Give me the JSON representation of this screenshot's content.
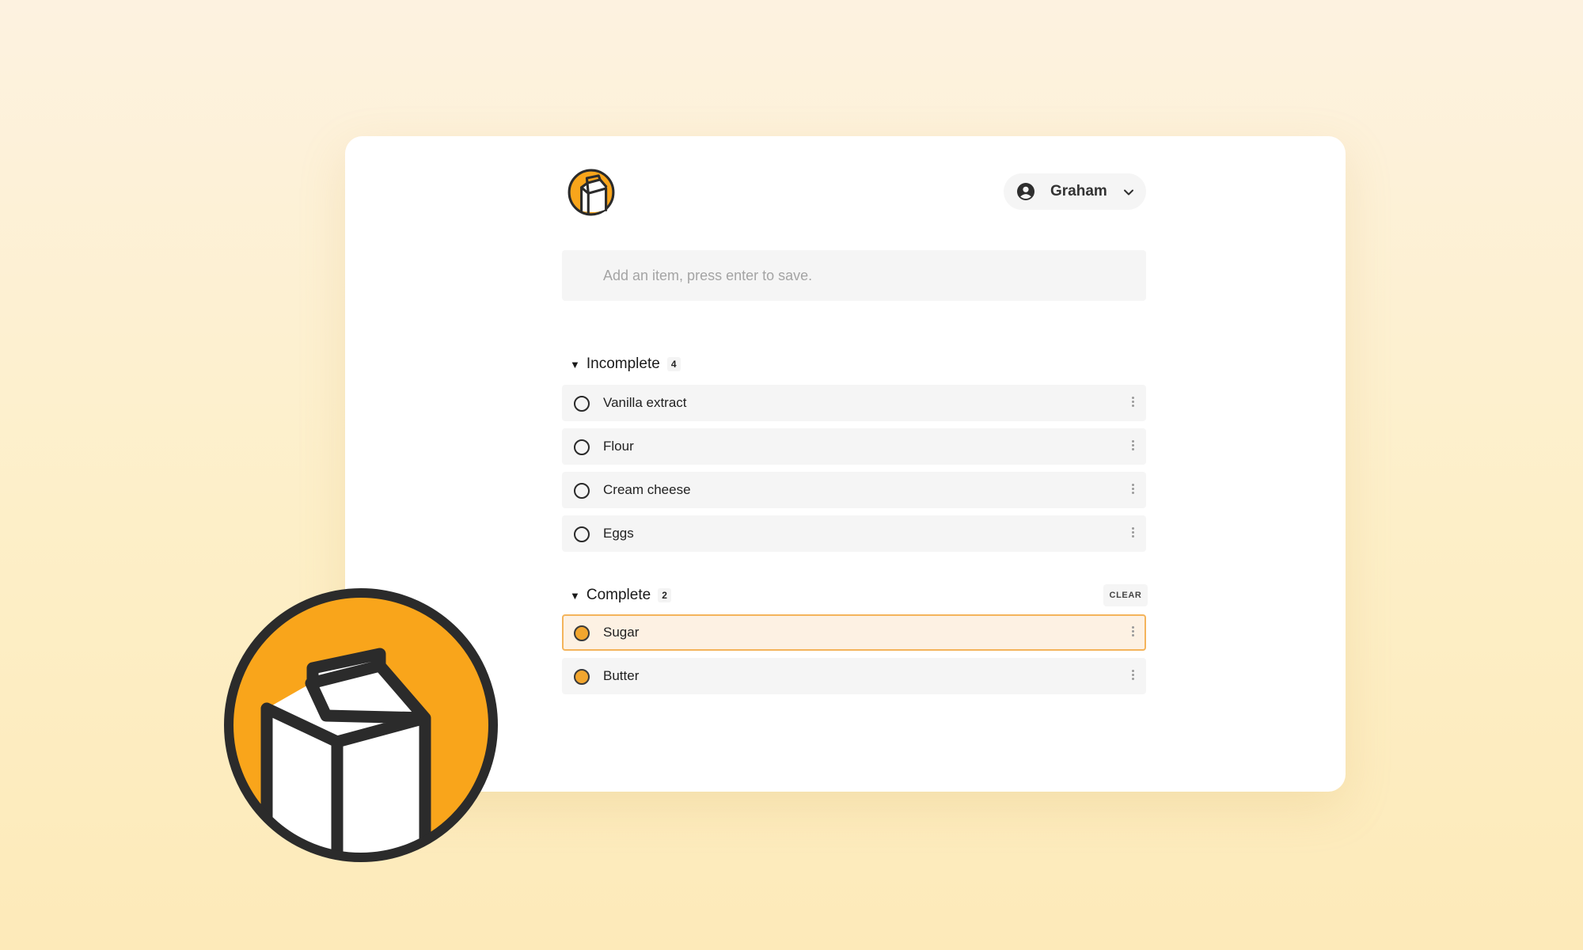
{
  "brand": {
    "logo_icon": "milk-carton-icon",
    "accent_color": "#F9A51B"
  },
  "header": {
    "user_name": "Graham",
    "user_icon": "user-circle-icon",
    "menu_icon": "chevron-down-icon"
  },
  "add_item": {
    "placeholder": "Add an item, press enter to save."
  },
  "incomplete": {
    "title": "Incomplete",
    "count": "4",
    "items": [
      {
        "label": "Vanilla extract"
      },
      {
        "label": "Flour"
      },
      {
        "label": "Cream cheese"
      },
      {
        "label": "Eggs"
      }
    ]
  },
  "complete": {
    "title": "Complete",
    "count": "2",
    "clear_label": "CLEAR",
    "items": [
      {
        "label": "Sugar",
        "selected": true
      },
      {
        "label": "Butter",
        "selected": false
      }
    ]
  }
}
